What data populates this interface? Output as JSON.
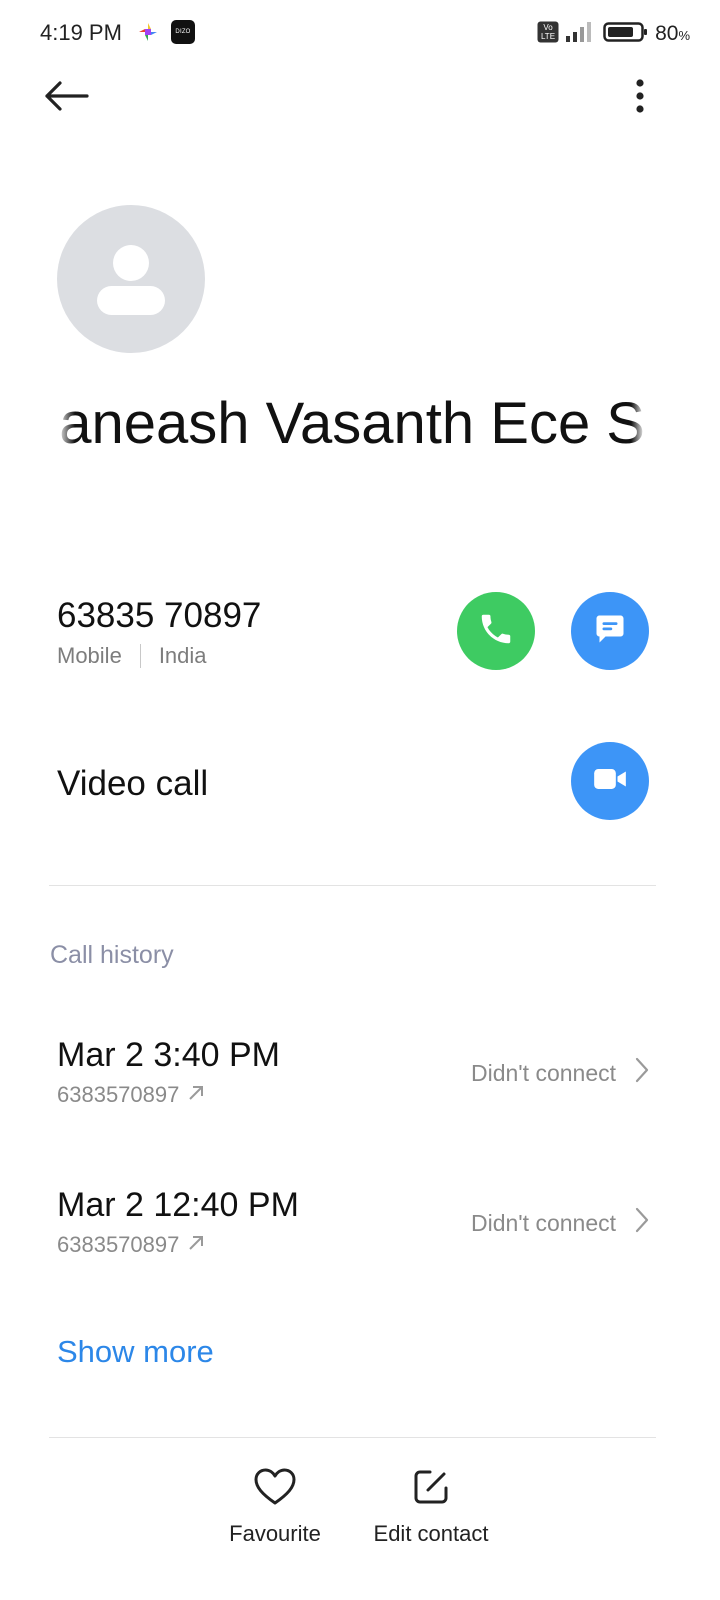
{
  "status_bar": {
    "time": "4:19 PM",
    "battery_percent": "80",
    "battery_unit": "%",
    "network_badge": "Vo LTE",
    "app_icons": [
      "pinwheel-app-icon",
      "dizo-app-icon"
    ],
    "dizo_label": "DIZO",
    "battery_level": 0.8
  },
  "toolbar": {
    "back_icon": "arrow-left-icon",
    "more_icon": "more-vertical-icon"
  },
  "contact": {
    "name": "Gaaneash Vasanth Ece S",
    "name_visible": "aneash Vasanth Ece S",
    "avatar_icon": "person-placeholder-icon"
  },
  "phone": {
    "number": "63835 70897",
    "type": "Mobile",
    "country": "India",
    "call_icon": "phone-icon",
    "message_icon": "message-icon"
  },
  "video": {
    "label": "Video call",
    "icon": "video-camera-icon"
  },
  "call_history": {
    "title": "Call history",
    "items": [
      {
        "datetime": "Mar 2 3:40 PM",
        "number": "6383570897",
        "status": "Didn't connect",
        "direction_icon": "outgoing-arrow-icon"
      },
      {
        "datetime": "Mar 2 12:40 PM",
        "number": "6383570897",
        "status": "Didn't connect",
        "direction_icon": "outgoing-arrow-icon"
      }
    ],
    "show_more": "Show more"
  },
  "bottom_actions": {
    "favourite": "Favourite",
    "edit_contact": "Edit contact"
  },
  "colors": {
    "call_green": "#3ecb62",
    "action_blue": "#3d95f7",
    "link_blue": "#2c87e8",
    "section_title": "#8b8fa6",
    "avatar_bg": "#dcdee2"
  }
}
